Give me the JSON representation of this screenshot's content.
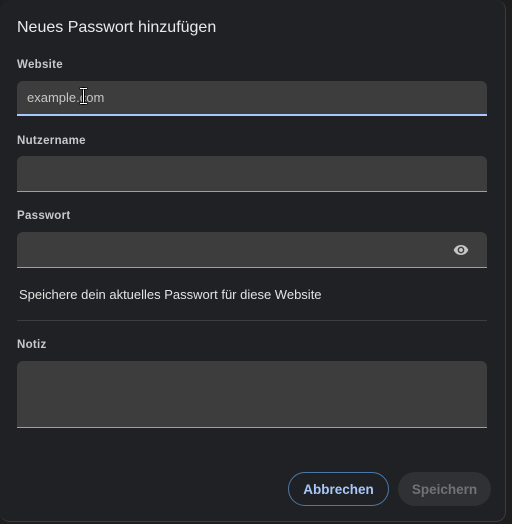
{
  "dialog": {
    "title": "Neues Passwort hinzufügen"
  },
  "website": {
    "label": "Website",
    "placeholder": "example.com",
    "value": ""
  },
  "username": {
    "label": "Nutzername",
    "value": ""
  },
  "password": {
    "label": "Passwort",
    "value": "",
    "visibility_icon": "eye-icon"
  },
  "hint": "Speichere dein aktuelles Passwort für diese Website",
  "note": {
    "label": "Notiz",
    "value": ""
  },
  "buttons": {
    "cancel_label": "Abbrechen",
    "save_label": "Speichern"
  },
  "colors": {
    "accent": "#a8c7fa",
    "background": "#202124",
    "field": "#3c3d3c"
  }
}
